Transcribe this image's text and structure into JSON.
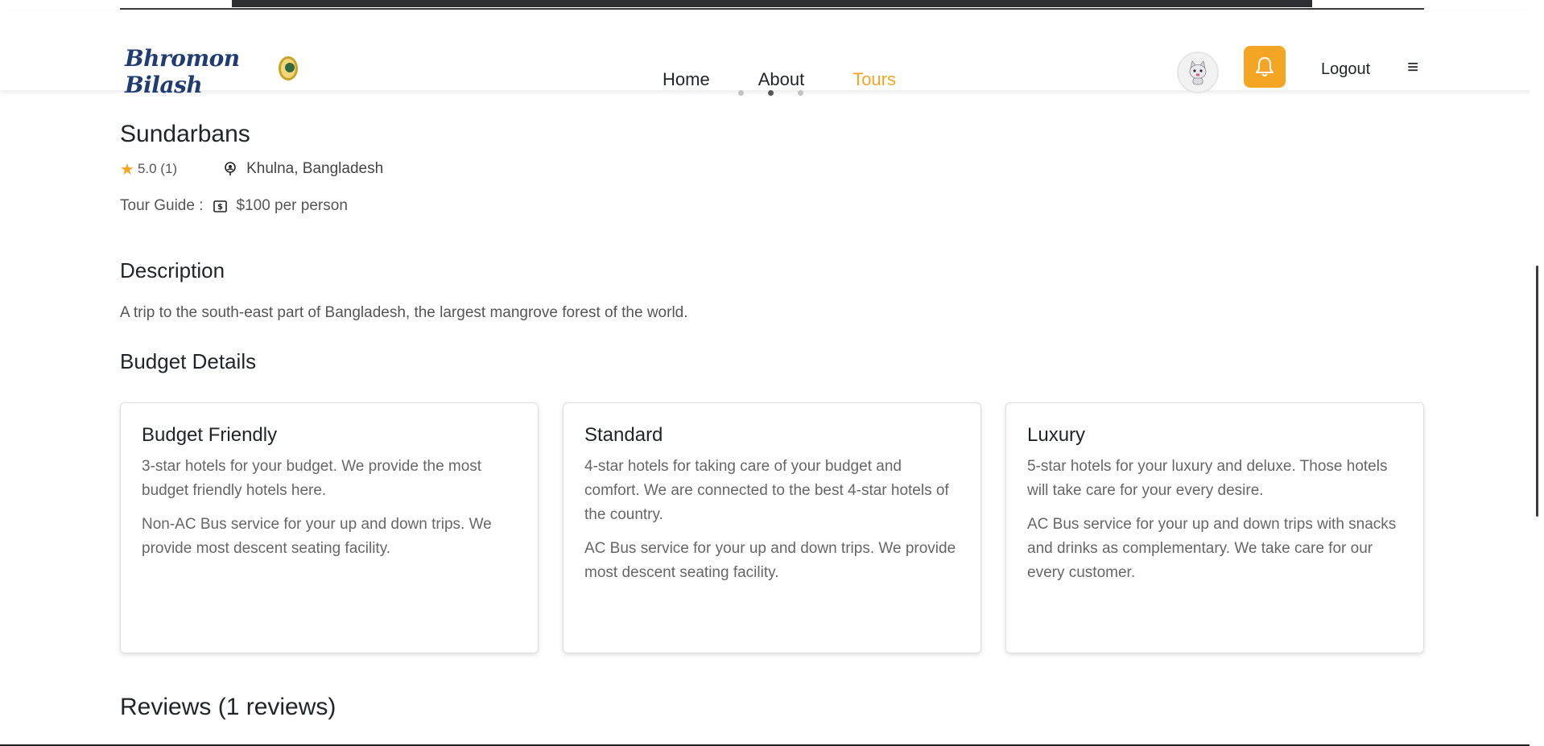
{
  "brand": {
    "name": "Bhromon Bilash"
  },
  "nav": {
    "links": [
      {
        "label": "Home",
        "active": false
      },
      {
        "label": "About",
        "active": false
      },
      {
        "label": "Tours",
        "active": true
      }
    ],
    "logout_label": "Logout",
    "menu_glyph": "≡",
    "accent_color": "#f5a524"
  },
  "carousel": {
    "dots": 3,
    "active_index": 1
  },
  "tour": {
    "title": "Sundarbans",
    "rating": "5.0 (1)",
    "location": "Khulna, Bangladesh",
    "guide_label": "Tour Guide :",
    "guide_price": "$100 per person"
  },
  "description": {
    "heading": "Description",
    "text": "A trip to the south-east part of Bangladesh, the largest mangrove forest of the world."
  },
  "budget": {
    "heading": "Budget Details",
    "cards": [
      {
        "title": "Budget Friendly",
        "hotel": "3-star hotels for your budget. We provide the most budget friendly hotels here.",
        "transport": "Non-AC Bus service for your up and down trips. We provide most descent seating facility."
      },
      {
        "title": "Standard",
        "hotel": "4-star hotels for taking care of your budget and comfort. We are connected to the best 4-star hotels of the country.",
        "transport": "AC Bus service for your up and down trips. We provide most descent seating facility."
      },
      {
        "title": "Luxury",
        "hotel": "5-star hotels for your luxury and deluxe. Those hotels will take care for your every desire.",
        "transport": "AC Bus service for your up and down trips with snacks and drinks as complementary. We take care for our every customer."
      }
    ]
  },
  "reviews": {
    "heading": "Reviews (1 reviews)"
  },
  "icons": {
    "star": "star-icon",
    "location": "location-pin-icon",
    "money": "money-icon",
    "bell": "bell-icon",
    "avatar": "cat-avatar-icon",
    "menu": "hamburger-icon"
  }
}
